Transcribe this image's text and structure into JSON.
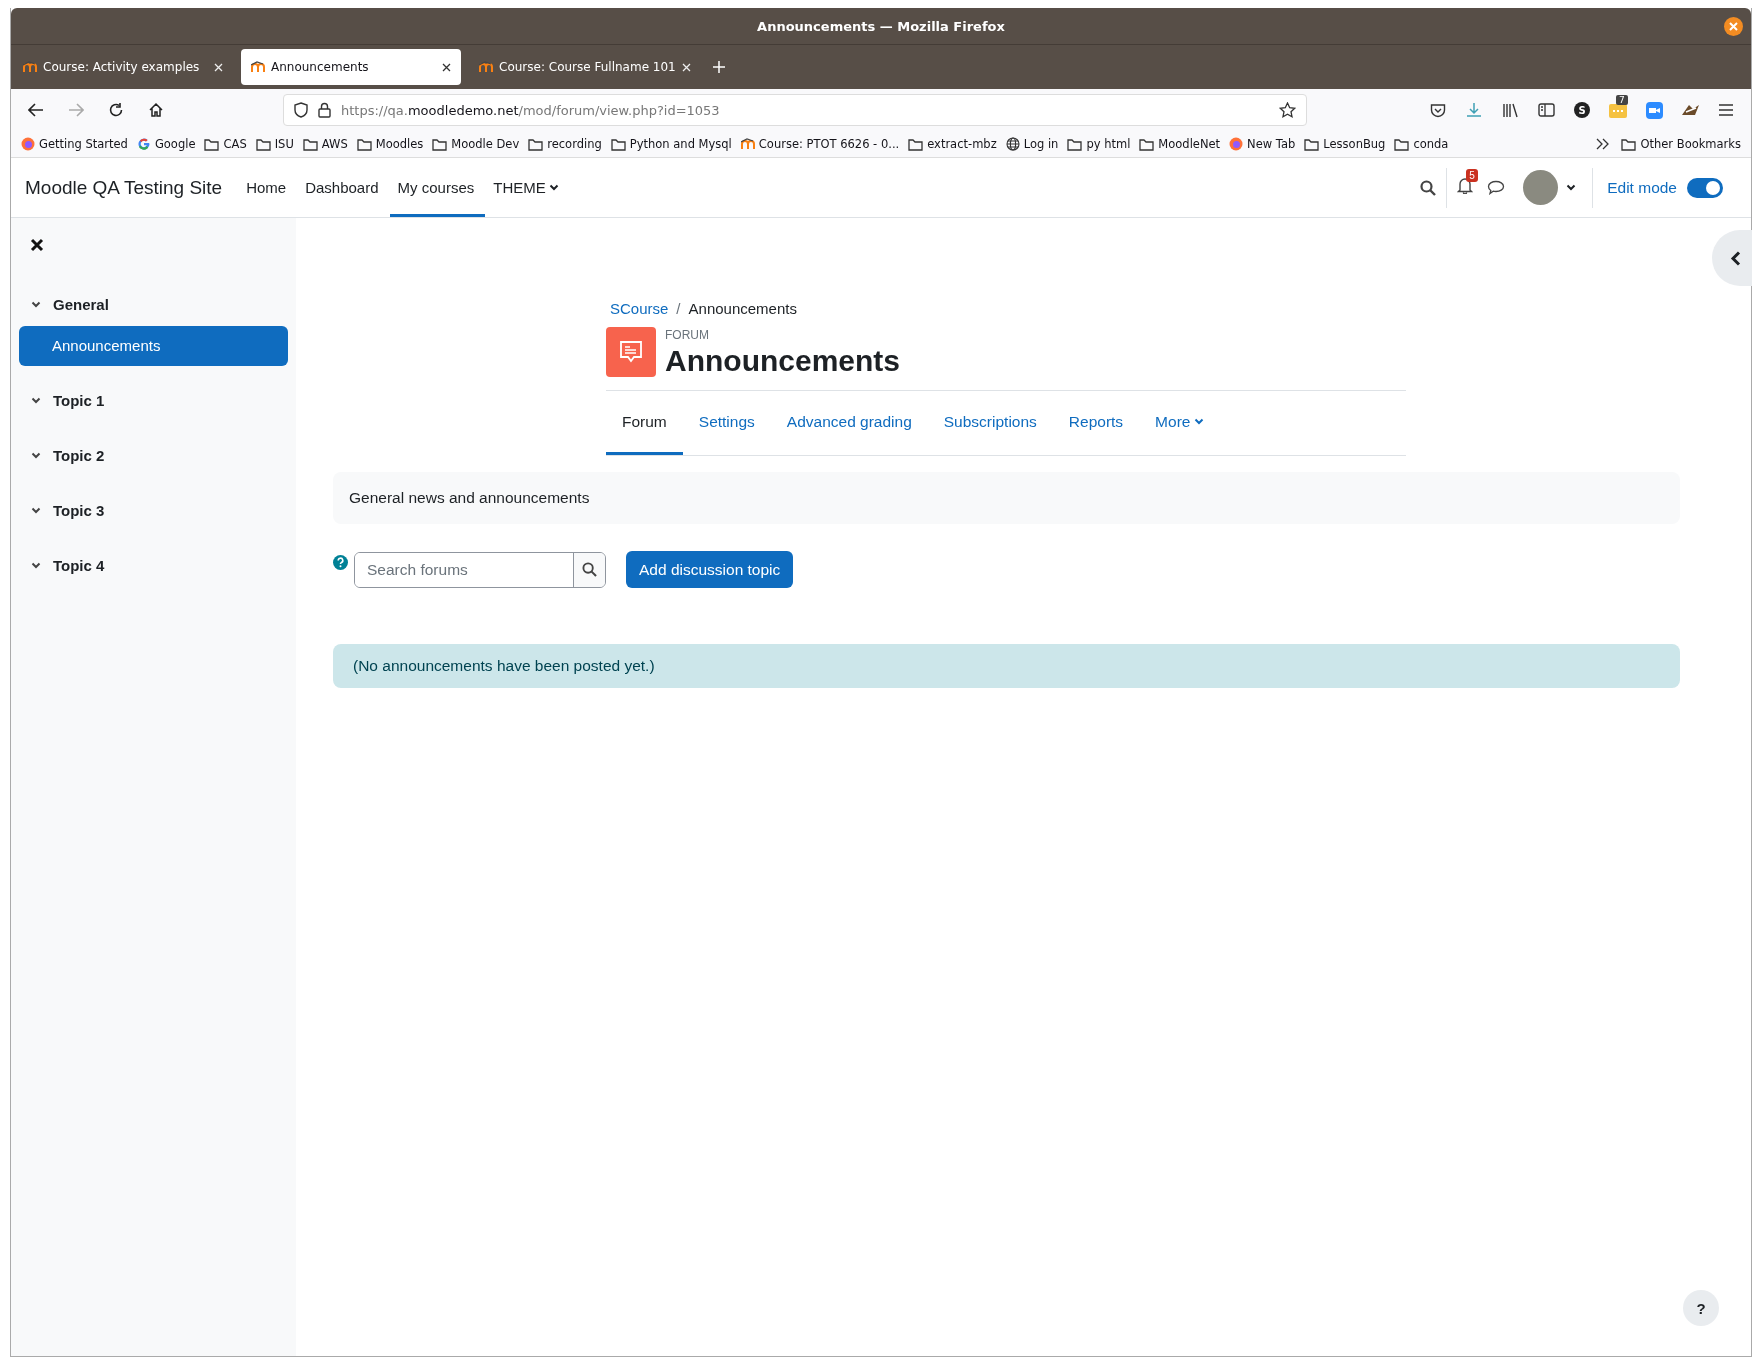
{
  "window": {
    "title": "Announcements — Mozilla Firefox"
  },
  "tabs": [
    {
      "label": "Course: Activity examples",
      "selected": false
    },
    {
      "label": "Announcements",
      "selected": true
    },
    {
      "label": "Course: Course Fullname 101",
      "selected": false
    }
  ],
  "address_bar": {
    "url_prefix": "https://qa.",
    "url_domain": "moodledemo.net",
    "url_path": "/mod/forum/view.php?id=1053"
  },
  "toolbar": {
    "extension_badge": "7",
    "account_letter": "S"
  },
  "bookmarks": [
    {
      "label": "Getting Started",
      "kind": "firefox"
    },
    {
      "label": "Google",
      "kind": "google"
    },
    {
      "label": "CAS",
      "kind": "folder"
    },
    {
      "label": "ISU",
      "kind": "folder"
    },
    {
      "label": "AWS",
      "kind": "folder"
    },
    {
      "label": "Moodles",
      "kind": "folder"
    },
    {
      "label": "Moodle Dev",
      "kind": "folder"
    },
    {
      "label": "recording",
      "kind": "folder"
    },
    {
      "label": "Python and Mysql",
      "kind": "folder"
    },
    {
      "label": "Course: PTOT 6626 - 0...",
      "kind": "moodle"
    },
    {
      "label": "extract-mbz",
      "kind": "folder"
    },
    {
      "label": "Log in",
      "kind": "globe"
    },
    {
      "label": "py html",
      "kind": "folder"
    },
    {
      "label": "MoodleNet",
      "kind": "folder"
    },
    {
      "label": "New Tab",
      "kind": "firefox"
    },
    {
      "label": "LessonBug",
      "kind": "folder"
    },
    {
      "label": "conda",
      "kind": "folder"
    }
  ],
  "other_bookmarks": "Other Bookmarks",
  "site": {
    "name": "Moodle QA Testing Site",
    "nav": [
      {
        "label": "Home",
        "selected": false,
        "dropdown": false
      },
      {
        "label": "Dashboard",
        "selected": false,
        "dropdown": false
      },
      {
        "label": "My courses",
        "selected": true,
        "dropdown": false
      },
      {
        "label": "THEME",
        "selected": false,
        "dropdown": true
      }
    ],
    "notification_count": "5",
    "edit_mode": {
      "label": "Edit mode",
      "on": true
    }
  },
  "sidebar": {
    "sections": [
      {
        "title": "General",
        "items": [
          {
            "label": "Announcements",
            "selected": true
          }
        ]
      },
      {
        "title": "Topic 1"
      },
      {
        "title": "Topic 2"
      },
      {
        "title": "Topic 3"
      },
      {
        "title": "Topic 4"
      }
    ]
  },
  "breadcrumb_separator": "/",
  "breadcrumb": [
    {
      "label": "SCourse",
      "kind": "link"
    },
    {
      "label": "Announcements",
      "kind": "current"
    }
  ],
  "activity": {
    "type_label": "FORUM",
    "title": "Announcements"
  },
  "secondary_nav": [
    {
      "label": "Forum",
      "selected": true,
      "dropdown": false
    },
    {
      "label": "Settings",
      "selected": false,
      "dropdown": false
    },
    {
      "label": "Advanced grading",
      "selected": false,
      "dropdown": false
    },
    {
      "label": "Subscriptions",
      "selected": false,
      "dropdown": false
    },
    {
      "label": "Reports",
      "selected": false,
      "dropdown": false
    },
    {
      "label": "More",
      "selected": false,
      "dropdown": true
    }
  ],
  "intro": "General news and announcements",
  "search": {
    "placeholder": "Search forums"
  },
  "add_button": "Add discussion topic",
  "notice": "(No announcements have been posted yet.)",
  "help_button": "?"
}
